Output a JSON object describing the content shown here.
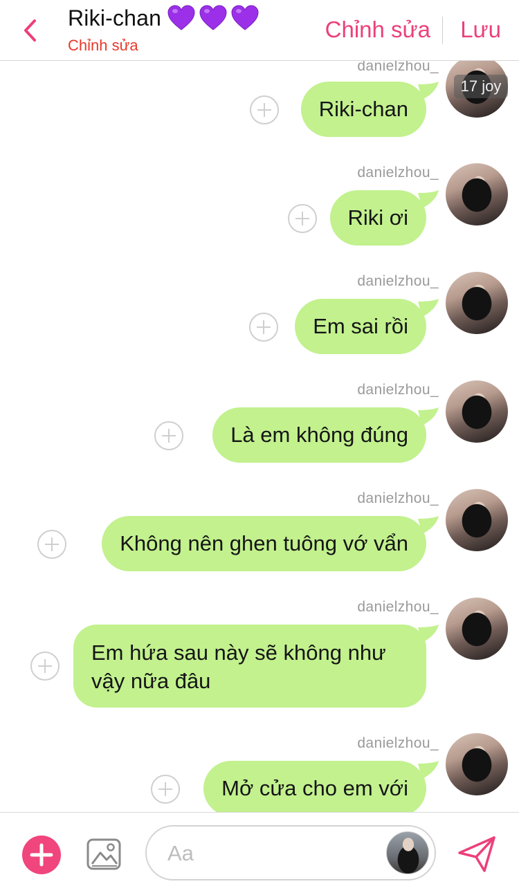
{
  "header": {
    "title": "Riki-chan",
    "subtitle": "Chỉnh sửa",
    "edit_label": "Chỉnh sửa",
    "save_label": "Lưu"
  },
  "watermark": "17 joy",
  "messages": [
    {
      "sender": "danielzhou_",
      "text": "Riki-chan"
    },
    {
      "sender": "danielzhou_",
      "text": "Riki ơi"
    },
    {
      "sender": "danielzhou_",
      "text": "Em sai rồi"
    },
    {
      "sender": "danielzhou_",
      "text": "Là em không đúng"
    },
    {
      "sender": "danielzhou_",
      "text": "Không nên ghen tuông vớ vẩn"
    },
    {
      "sender": "danielzhou_",
      "text": "Em hứa sau này sẽ không như vậy nữa đâu"
    },
    {
      "sender": "danielzhou_",
      "text": "Mở cửa cho em với"
    }
  ],
  "composer": {
    "placeholder": "Aa",
    "value": ""
  },
  "icons": {
    "back": "chevron-left-icon",
    "hearts": "purple-heart-icon",
    "add": "plus-icon",
    "image": "image-icon",
    "send": "send-icon",
    "bubble_add": "circle-plus-icon"
  },
  "colors": {
    "accent": "#ec407a",
    "subtitle": "#e8382c",
    "bubble": "#c2f18e",
    "heart": "#9b30e8"
  }
}
